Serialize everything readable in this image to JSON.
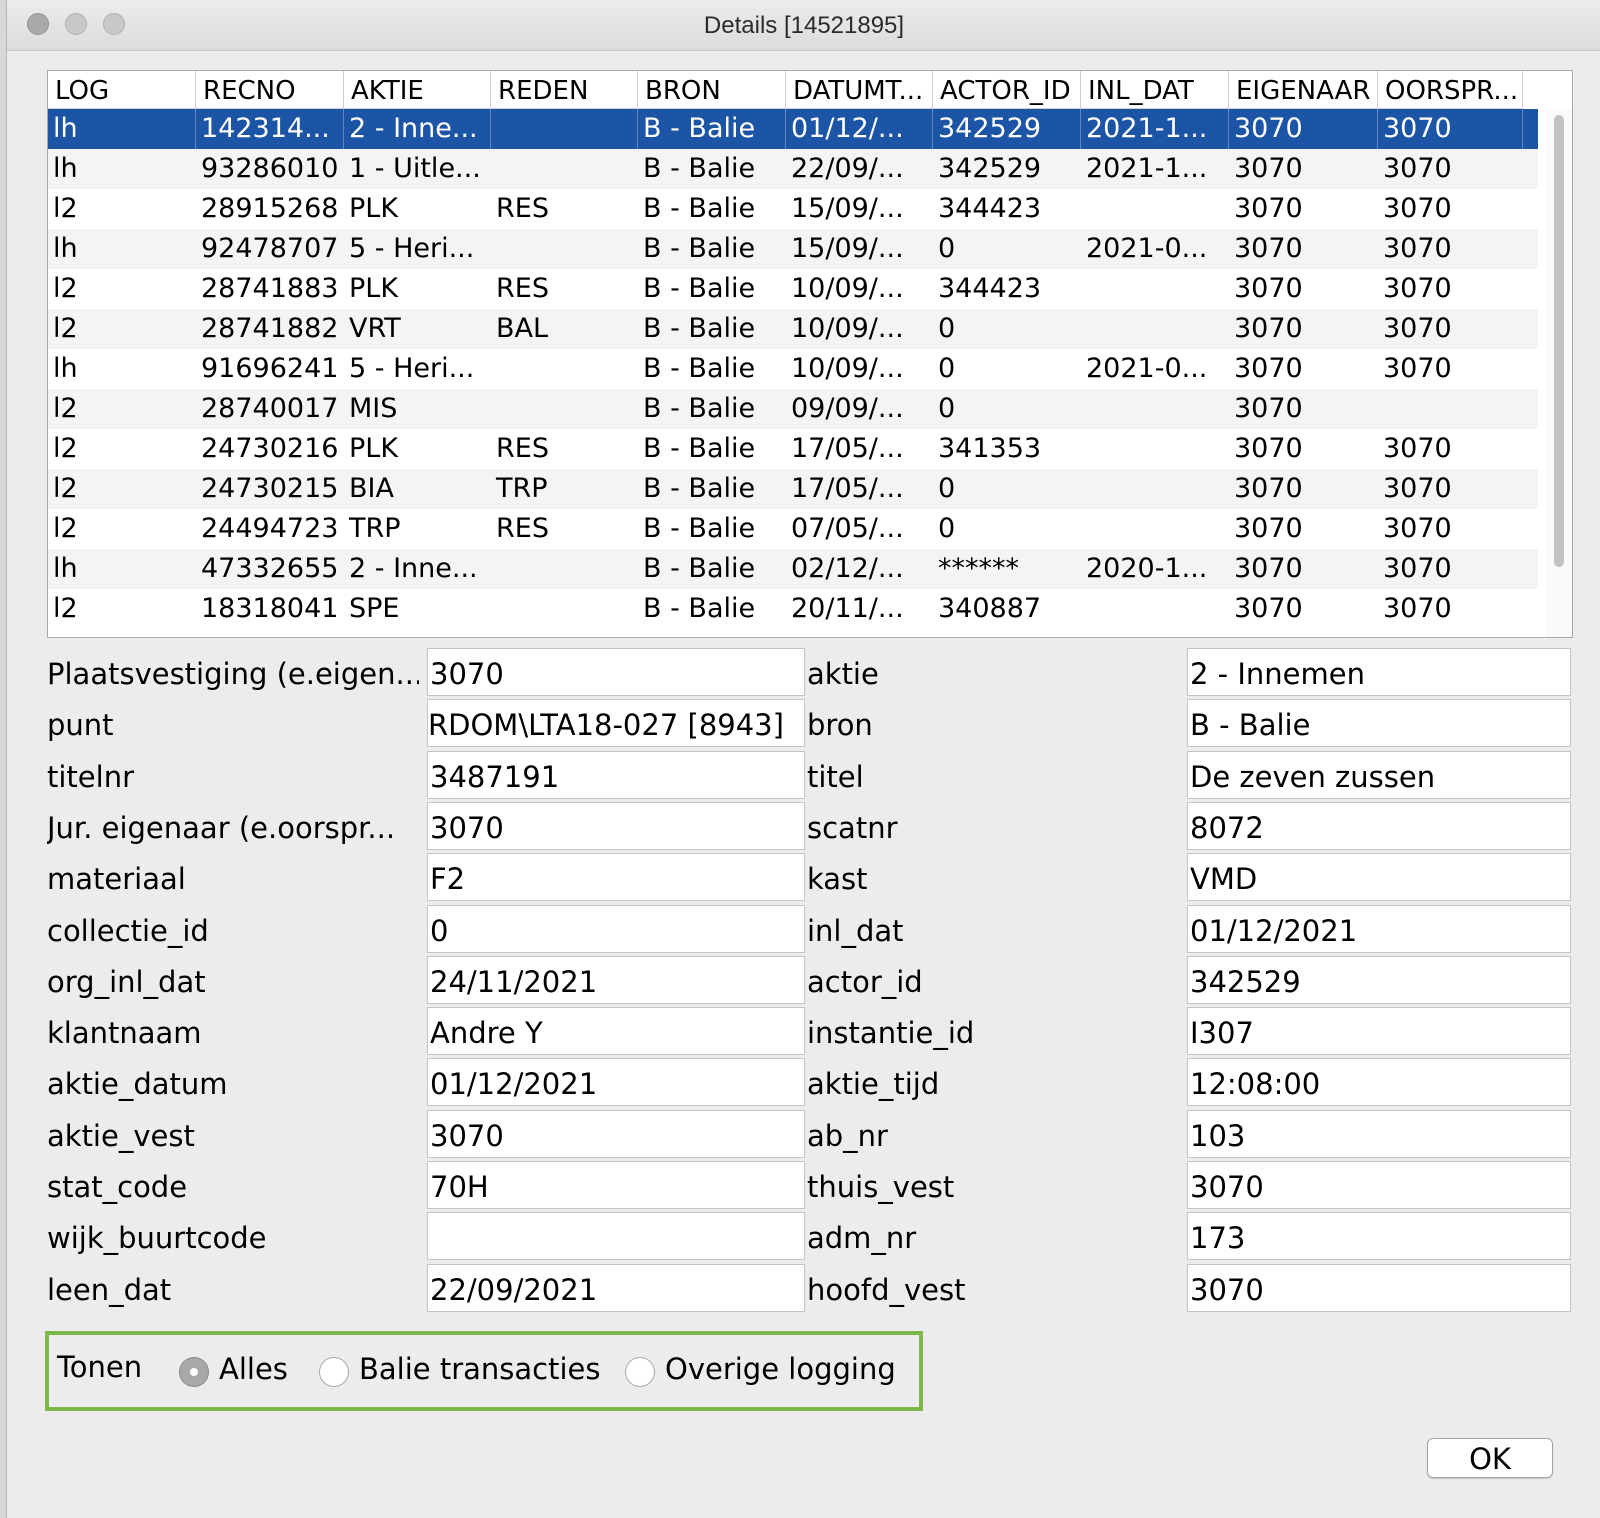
{
  "window": {
    "title": "Details [14521895]"
  },
  "table": {
    "columns": [
      "LOG",
      "RECNO",
      "AKTIE",
      "REDEN",
      "BRON",
      "DATUMT...",
      "ACTOR_ID",
      "INL_DAT",
      "EIGENAAR",
      "OORSPR..."
    ],
    "selected_row": 0,
    "rows": [
      [
        "lh",
        "142314...",
        "2 - Inne...",
        "",
        "B - Balie",
        "01/12/...",
        "342529",
        "2021-1...",
        "3070",
        "3070"
      ],
      [
        "lh",
        "93286010",
        "1 - Uitle...",
        "",
        "B - Balie",
        "22/09/...",
        "342529",
        "2021-1...",
        "3070",
        "3070"
      ],
      [
        "l2",
        "28915268",
        "PLK",
        "RES",
        "B - Balie",
        "15/09/...",
        "344423",
        "",
        "3070",
        "3070"
      ],
      [
        "lh",
        "92478707",
        "5 - Heri...",
        "",
        "B - Balie",
        "15/09/...",
        "0",
        "2021-0...",
        "3070",
        "3070"
      ],
      [
        "l2",
        "28741883",
        "PLK",
        "RES",
        "B - Balie",
        "10/09/...",
        "344423",
        "",
        "3070",
        "3070"
      ],
      [
        "l2",
        "28741882",
        "VRT",
        "BAL",
        "B - Balie",
        "10/09/...",
        "0",
        "",
        "3070",
        "3070"
      ],
      [
        "lh",
        "91696241",
        "5 - Heri...",
        "",
        "B - Balie",
        "10/09/...",
        "0",
        "2021-0...",
        "3070",
        "3070"
      ],
      [
        "l2",
        "28740017",
        "MIS",
        "",
        "B - Balie",
        "09/09/...",
        "0",
        "",
        "3070",
        ""
      ],
      [
        "l2",
        "24730216",
        "PLK",
        "RES",
        "B - Balie",
        "17/05/...",
        "341353",
        "",
        "3070",
        "3070"
      ],
      [
        "l2",
        "24730215",
        "BIA",
        "TRP",
        "B - Balie",
        "17/05/...",
        "0",
        "",
        "3070",
        "3070"
      ],
      [
        "l2",
        "24494723",
        "TRP",
        "RES",
        "B - Balie",
        "07/05/...",
        "0",
        "",
        "3070",
        "3070"
      ],
      [
        "lh",
        "47332655",
        "2 - Inne...",
        "",
        "B - Balie",
        "02/12/...",
        "******",
        "2020-1...",
        "3070",
        "3070"
      ],
      [
        "l2",
        "18318041",
        "SPE",
        "",
        "B - Balie",
        "20/11/...",
        "340887",
        "",
        "3070",
        "3070"
      ]
    ]
  },
  "form": {
    "left": [
      {
        "label": "Plaatsvestiging (e.eigen...",
        "value": "3070"
      },
      {
        "label": "punt",
        "value": "RDOM\\LTA18-027 [8943]"
      },
      {
        "label": "titelnr",
        "value": "3487191"
      },
      {
        "label": "Jur. eigenaar (e.oorspr...",
        "value": "3070"
      },
      {
        "label": "materiaal",
        "value": "F2"
      },
      {
        "label": "collectie_id",
        "value": "0"
      },
      {
        "label": "org_inl_dat",
        "value": "24/11/2021"
      },
      {
        "label": "klantnaam",
        "value": "Andre Y"
      },
      {
        "label": "aktie_datum",
        "value": "01/12/2021"
      },
      {
        "label": "aktie_vest",
        "value": "3070"
      },
      {
        "label": "stat_code",
        "value": "70H"
      },
      {
        "label": "wijk_buurtcode",
        "value": ""
      },
      {
        "label": "leen_dat",
        "value": "22/09/2021"
      }
    ],
    "right": [
      {
        "label": "aktie",
        "value": "2 - Innemen"
      },
      {
        "label": "bron",
        "value": "B - Balie"
      },
      {
        "label": "titel",
        "value": "De zeven zussen"
      },
      {
        "label": "scatnr",
        "value": "8072"
      },
      {
        "label": "kast",
        "value": "VMD"
      },
      {
        "label": "inl_dat",
        "value": "01/12/2021"
      },
      {
        "label": "actor_id",
        "value": "342529"
      },
      {
        "label": "instantie_id",
        "value": "I307"
      },
      {
        "label": "aktie_tijd",
        "value": "12:08:00"
      },
      {
        "label": "ab_nr",
        "value": "103"
      },
      {
        "label": "thuis_vest",
        "value": "3070"
      },
      {
        "label": "adm_nr",
        "value": "173"
      },
      {
        "label": "hoofd_vest",
        "value": "3070"
      }
    ]
  },
  "filter": {
    "label": "Tonen",
    "options": [
      "Alles",
      "Balie transacties",
      "Overige logging"
    ],
    "selected": "Alles"
  },
  "buttons": {
    "ok": "OK"
  },
  "colors": {
    "selection": "#1d55a6",
    "group_border": "#7cb84a"
  }
}
